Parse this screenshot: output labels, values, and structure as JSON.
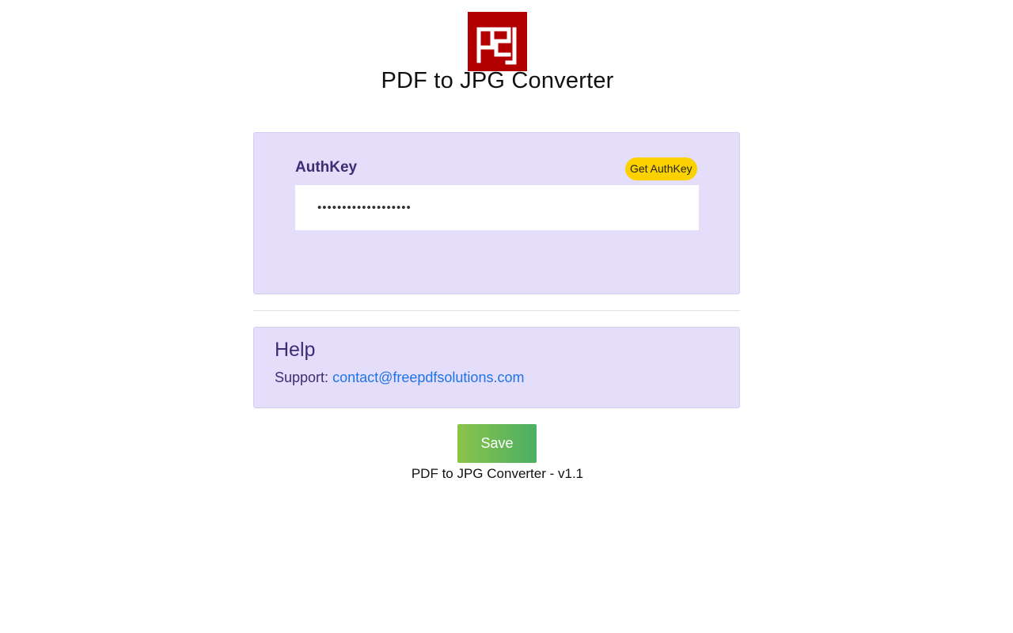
{
  "header": {
    "logo_text": "p2j",
    "title": "PDF to JPG Converter"
  },
  "auth": {
    "label": "AuthKey",
    "get_key_label": "Get AuthKey",
    "input_value": "•••••••••••••••••••"
  },
  "help": {
    "title": "Help",
    "support_prefix": "Support:",
    "support_email": "contact@freepdfsolutions.com"
  },
  "footer": {
    "save_label": "Save",
    "version_text": "PDF to JPG Converter - v1.1"
  },
  "colors": {
    "logo_bg": "#b20000",
    "card_bg": "#e4defa",
    "label_text": "#3f2c74",
    "accent_yellow": "#fbd200",
    "link": "#1f73e8",
    "save_start": "#8bc34a",
    "save_end": "#4caf64"
  }
}
